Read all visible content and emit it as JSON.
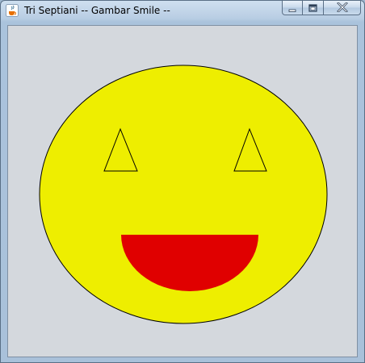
{
  "window": {
    "title": "Tri Septiani -- Gambar Smile --",
    "app_icon": "java-cup-icon",
    "buttons": {
      "minimize_icon": "minimize-icon",
      "maximize_icon": "maximize-icon",
      "close_icon": "close-icon"
    }
  },
  "drawing": {
    "background_color": "#d4d8dd",
    "face_color": "#eeee00",
    "mouth_color": "#e00000",
    "outline_color": "#000000",
    "shapes": [
      "face",
      "left-eye",
      "right-eye",
      "mouth"
    ]
  }
}
